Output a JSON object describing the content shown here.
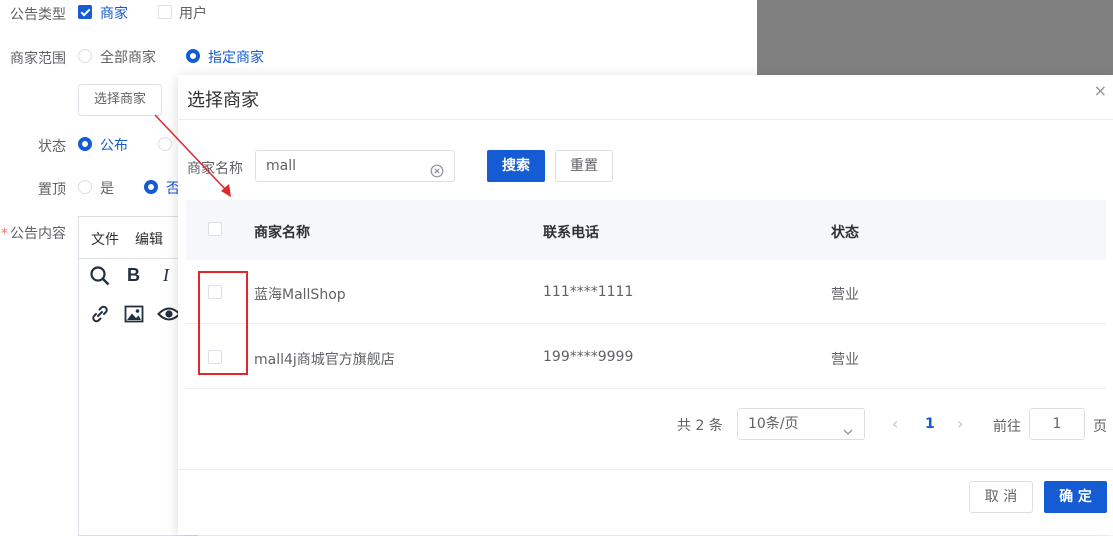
{
  "form": {
    "notice_type_label": "公告类型",
    "notice_type_options": [
      "商家",
      "用户"
    ],
    "merchant_scope_label": "商家范围",
    "merchant_scope_options": [
      "全部商家",
      "指定商家"
    ],
    "select_merchant_button": "选择商家",
    "status_label": "状态",
    "status_options": [
      "公布",
      ""
    ],
    "pin_label": "置顶",
    "pin_options": [
      "是",
      "否"
    ],
    "content_label": "公告内容",
    "required_mark": "*"
  },
  "editor": {
    "menu": [
      "文件",
      "编辑"
    ],
    "toolbar_row1": [
      "search-icon",
      "bold-icon",
      "italic-icon"
    ],
    "toolbar_row2": [
      "link-icon",
      "image-icon",
      "eye-icon"
    ],
    "bold_glyph": "B",
    "italic_glyph": "I"
  },
  "dialog": {
    "title": "选择商家",
    "close_glyph": "×",
    "search_label": "商家名称",
    "search_value": "mall",
    "search_button": "搜索",
    "reset_button": "重置",
    "table": {
      "columns": [
        "商家名称",
        "联系电话",
        "状态"
      ],
      "rows": [
        {
          "name": "蓝海MallShop",
          "phone": "111****1111",
          "status": "营业"
        },
        {
          "name": "mall4j商城官方旗舰店",
          "phone": "199****9999",
          "status": "营业"
        }
      ]
    },
    "pagination": {
      "total": "共 2 条",
      "page_size": "10条/页",
      "prev": "‹",
      "current_page": "1",
      "next": "›",
      "goto_label": "前往",
      "goto_value": "1",
      "page_unit": "页"
    },
    "cancel_button": "取 消",
    "confirm_button": "确 定"
  },
  "colors": {
    "primary": "#155bd4",
    "annotation_red": "#e3262c",
    "overlay_gray": "#808080"
  }
}
